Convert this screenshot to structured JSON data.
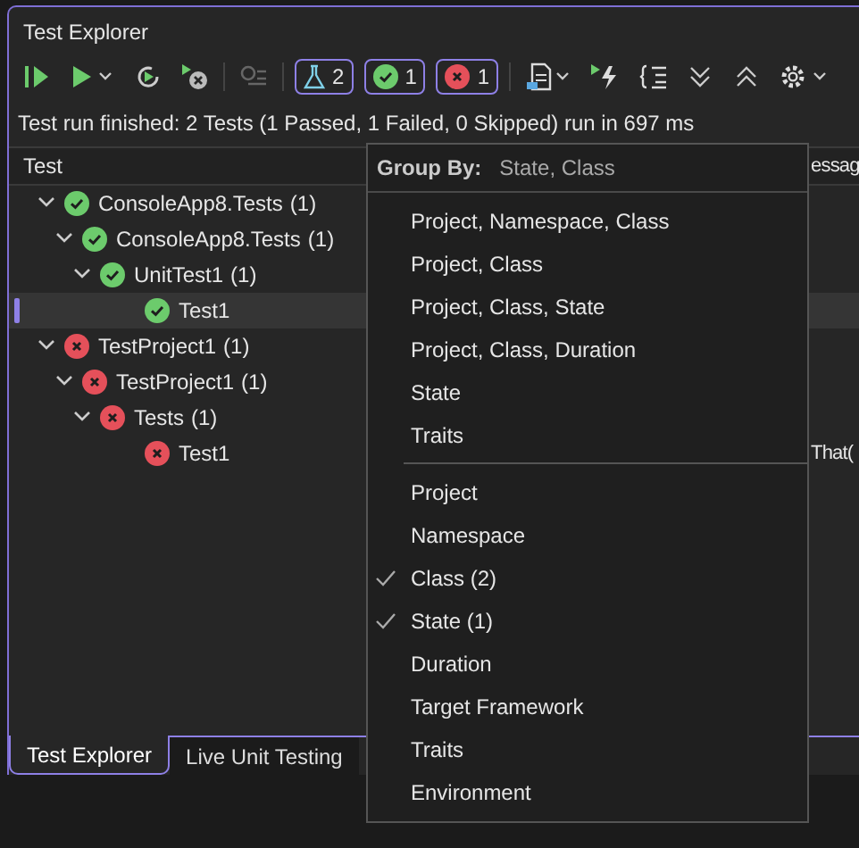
{
  "window": {
    "title": "Test Explorer"
  },
  "toolbar": {
    "filters": [
      {
        "kind": "total",
        "count": "2",
        "selected": true
      },
      {
        "kind": "passed",
        "count": "1",
        "selected": true
      },
      {
        "kind": "failed",
        "count": "1",
        "selected": true
      }
    ]
  },
  "status": "Test run finished: 2 Tests (1 Passed, 1 Failed, 0 Skipped) run in 697 ms",
  "table": {
    "columns": [
      "Test",
      "essag"
    ],
    "tree": [
      {
        "label": "ConsoleApp8.Tests",
        "count": "(1)",
        "kind": "passed",
        "expanded": true,
        "selected": false,
        "children": [
          {
            "label": "ConsoleApp8.Tests",
            "count": "(1)",
            "kind": "passed",
            "expanded": true,
            "selected": false,
            "children": [
              {
                "label": "UnitTest1",
                "count": "(1)",
                "kind": "passed",
                "expanded": true,
                "selected": false,
                "children": [
                  {
                    "label": "Test1",
                    "kind": "passed",
                    "selected": true
                  }
                ]
              }
            ]
          }
        ]
      },
      {
        "label": "TestProject1",
        "count": "(1)",
        "kind": "failed",
        "expanded": true,
        "selected": false,
        "children": [
          {
            "label": "TestProject1",
            "count": "(1)",
            "kind": "failed",
            "expanded": true,
            "selected": false,
            "children": [
              {
                "label": "Tests",
                "count": "(1)",
                "kind": "failed",
                "expanded": true,
                "selected": false,
                "children": [
                  {
                    "label": "Test1",
                    "kind": "failed",
                    "selected": false,
                    "column_2": "That("
                  }
                ]
              }
            ]
          }
        ]
      }
    ]
  },
  "group_by_menu": {
    "label": "Group By:",
    "value": "State, Class",
    "presets": [
      "Project, Namespace, Class",
      "Project, Class",
      "Project, Class, State",
      "Project, Class, Duration",
      "State",
      "Traits"
    ],
    "options": [
      {
        "label": "Project",
        "checked": false
      },
      {
        "label": "Namespace",
        "checked": false
      },
      {
        "label": "Class (2)",
        "checked": true
      },
      {
        "label": "State (1)",
        "checked": true
      },
      {
        "label": "Duration",
        "checked": false
      },
      {
        "label": "Target Framework",
        "checked": false
      },
      {
        "label": "Traits",
        "checked": false
      },
      {
        "label": "Environment",
        "checked": false
      }
    ]
  },
  "bottom_tabs": [
    {
      "label": "Test Explorer",
      "selected": true
    },
    {
      "label": "Live Unit Testing",
      "selected": false
    }
  ]
}
